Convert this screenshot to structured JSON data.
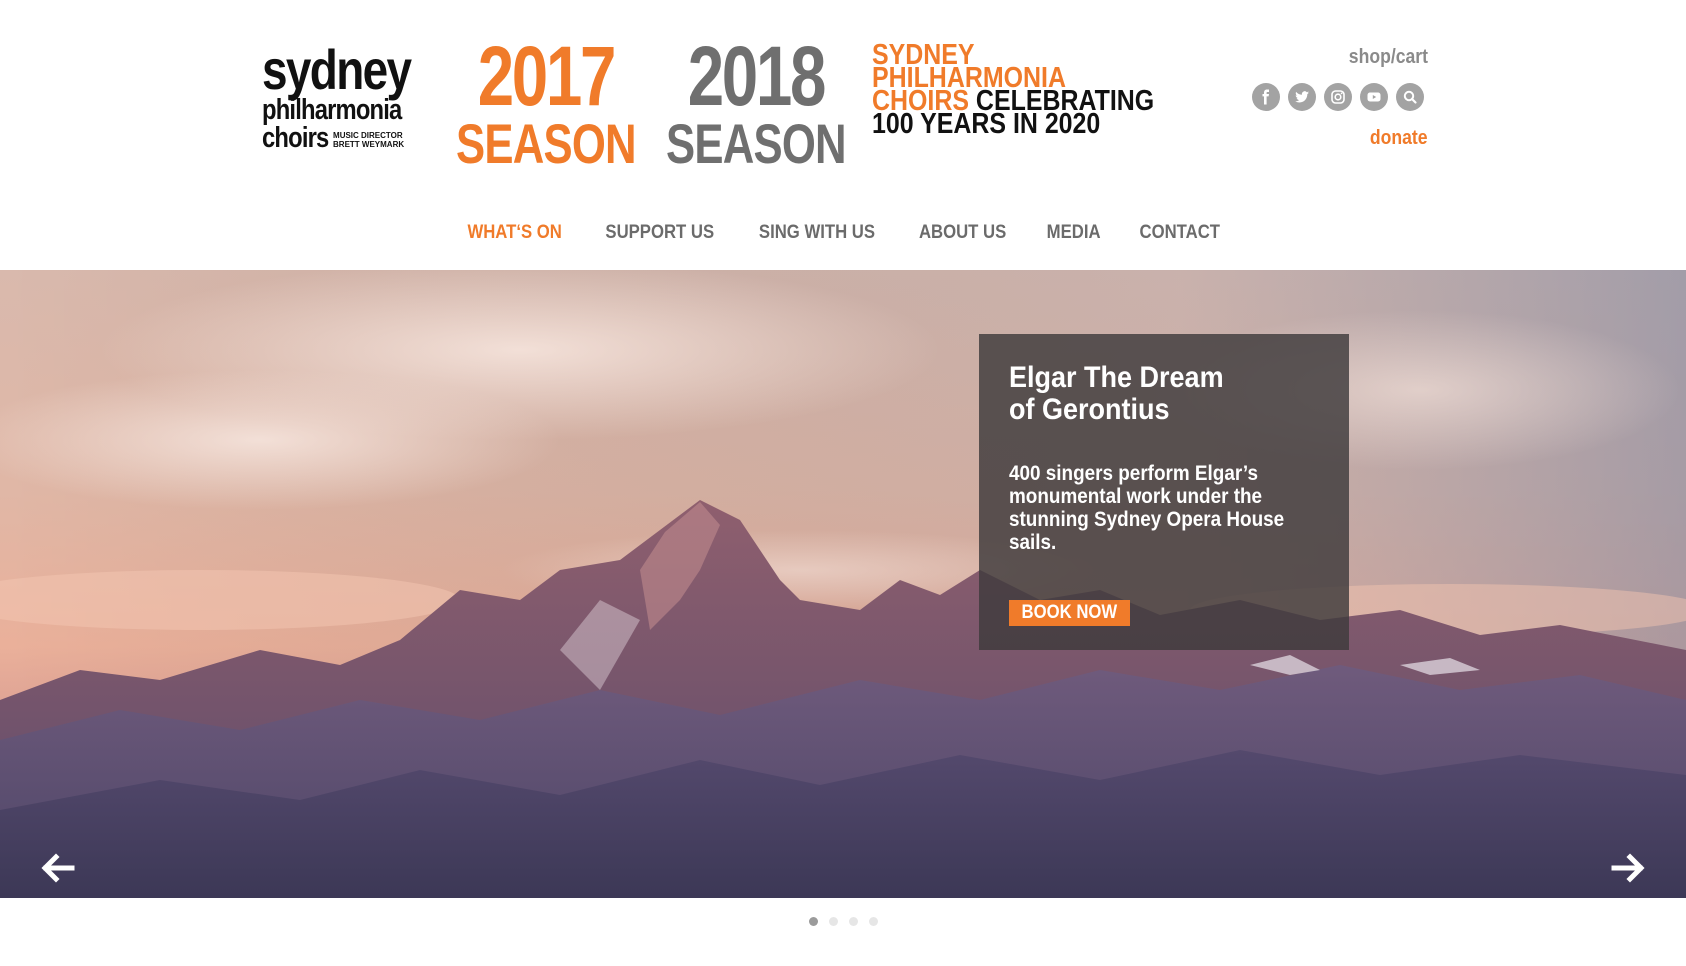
{
  "logo": {
    "line1": "sydney",
    "line2": "philharmonia",
    "line3": "choirs",
    "music_director_line1": "MUSIC DIRECTOR",
    "music_director_line2": "BRETT WEYMARK"
  },
  "seasons": [
    {
      "year": "2017",
      "label": "SEASON",
      "color": "#f07b2a"
    },
    {
      "year": "2018",
      "label": "SEASON",
      "color": "#6f6f6f"
    }
  ],
  "celebrate": {
    "orange_line1": "SYDNEY PHILHARMONIA",
    "orange_line2": "CHOIRS",
    "dark_part": " CELEBRATING 100 YEARS IN 2020"
  },
  "header_links": {
    "shop": "shop/cart",
    "donate": "donate"
  },
  "social_icons": [
    "facebook-icon",
    "twitter-icon",
    "instagram-icon",
    "youtube-icon",
    "search-icon"
  ],
  "nav": {
    "items": [
      {
        "label": "WHAT‘S ON",
        "active": true
      },
      {
        "label": "SUPPORT US",
        "active": false
      },
      {
        "label": "SING WITH US",
        "active": false
      },
      {
        "label": "ABOUT US",
        "active": false
      },
      {
        "label": "MEDIA",
        "active": false
      },
      {
        "label": "CONTACT",
        "active": false
      }
    ]
  },
  "hero": {
    "title": "Elgar The Dream of Gerontius",
    "description": "400 singers perform Elgar’s monumental work under the stunning Sydney Opera House sails.",
    "cta": "BOOK NOW",
    "slide_count": 4,
    "active_slide": 1
  },
  "colors": {
    "accent": "#f07b2a",
    "grey": "#6f6f6f",
    "card_bg": "#3e3a3c"
  }
}
